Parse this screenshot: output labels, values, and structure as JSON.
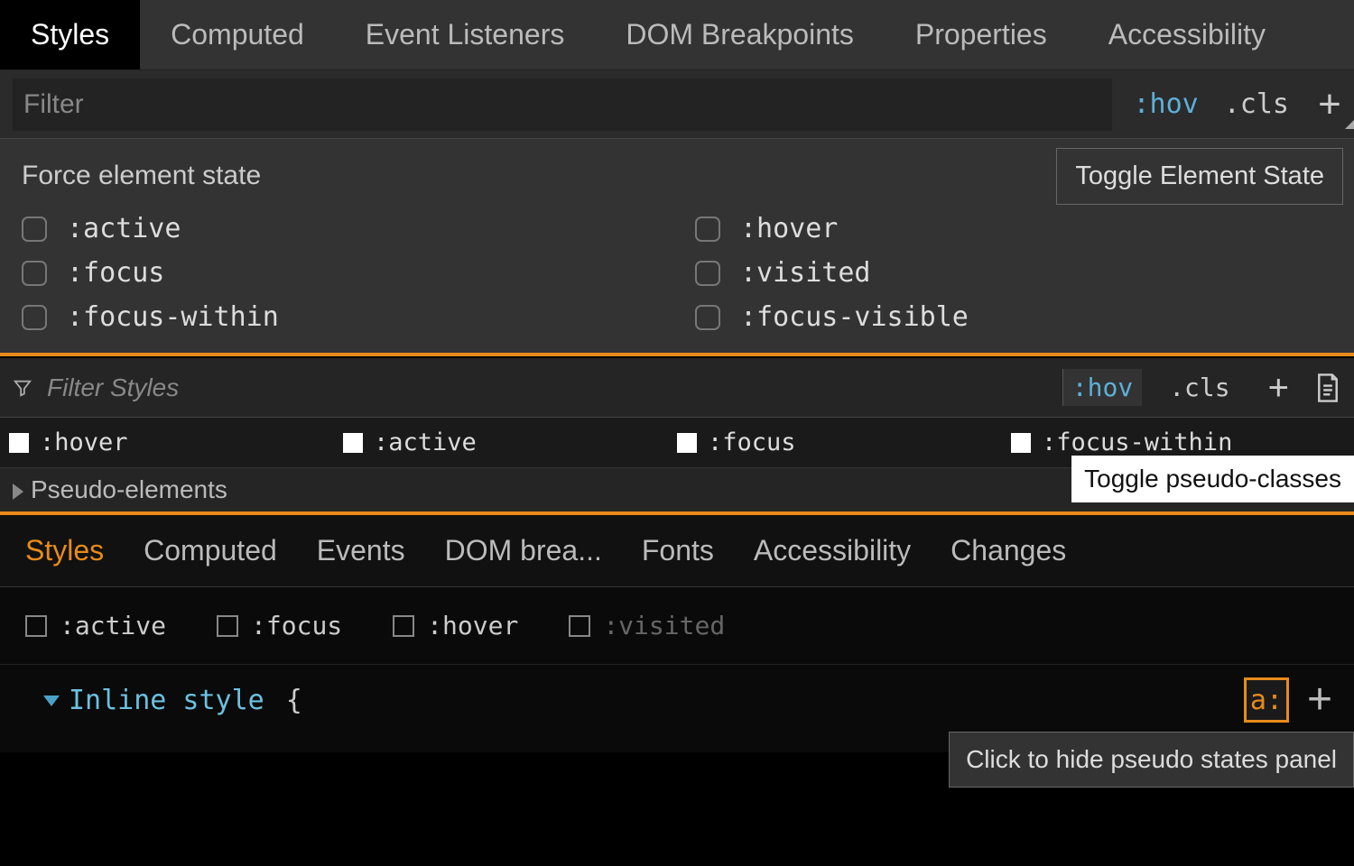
{
  "panel1": {
    "tabs": [
      "Styles",
      "Computed",
      "Event Listeners",
      "DOM Breakpoints",
      "Properties",
      "Accessibility"
    ],
    "active_tab": "Styles",
    "filter_placeholder": "Filter",
    "hov_label": ":hov",
    "cls_label": ".cls",
    "force_title": "Force element state",
    "states_left": [
      ":active",
      ":focus",
      ":focus-within"
    ],
    "states_right": [
      ":hover",
      ":visited",
      ":focus-visible"
    ],
    "tooltip": "Toggle Element State"
  },
  "panel2": {
    "filter_placeholder": "Filter Styles",
    "hov_label": ":hov",
    "cls_label": ".cls",
    "states": [
      ":hover",
      ":active",
      ":focus",
      ":focus-within"
    ],
    "tooltip": "Toggle pseudo-classes",
    "pseudo_section": "Pseudo-elements"
  },
  "panel3": {
    "tabs": [
      "Styles",
      "Computed",
      "Events",
      "DOM brea...",
      "Fonts",
      "Accessibility",
      "Changes"
    ],
    "active_tab": "Styles",
    "states": [
      {
        "label": ":active",
        "dim": false
      },
      {
        "label": ":focus",
        "dim": false
      },
      {
        "label": ":hover",
        "dim": false
      },
      {
        "label": ":visited",
        "dim": true
      }
    ],
    "rule_name": "Inline style",
    "rule_brace": "{",
    "abtn_label": "a:",
    "tooltip": "Click to hide pseudo states panel"
  }
}
